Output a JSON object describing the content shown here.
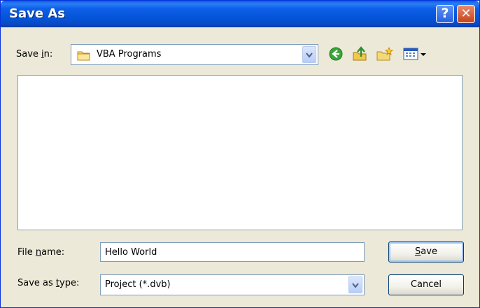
{
  "window": {
    "title": "Save As",
    "help_glyph": "?",
    "close_glyph": "✕"
  },
  "toolbar": {
    "save_in_prefix": "Save ",
    "save_in_accel": "i",
    "save_in_suffix": "n:",
    "location": "VBA Programs",
    "icons": [
      "folder-icon",
      "back-icon",
      "up-folder-icon",
      "new-folder-icon",
      "views-menu-icon"
    ]
  },
  "form": {
    "file_name_prefix": "File ",
    "file_name_accel": "n",
    "file_name_suffix": "ame:",
    "file_name_value": "Hello World",
    "type_prefix": "Save as ",
    "type_accel": "t",
    "type_suffix": "ype:",
    "type_value": "Project (*.dvb)"
  },
  "buttons": {
    "save_accel": "S",
    "save_rest": "ave",
    "cancel": "Cancel"
  },
  "colors": {
    "title_bar": "#0453d6",
    "dialog_bg": "#ece9d8",
    "close_red": "#c6421c"
  }
}
